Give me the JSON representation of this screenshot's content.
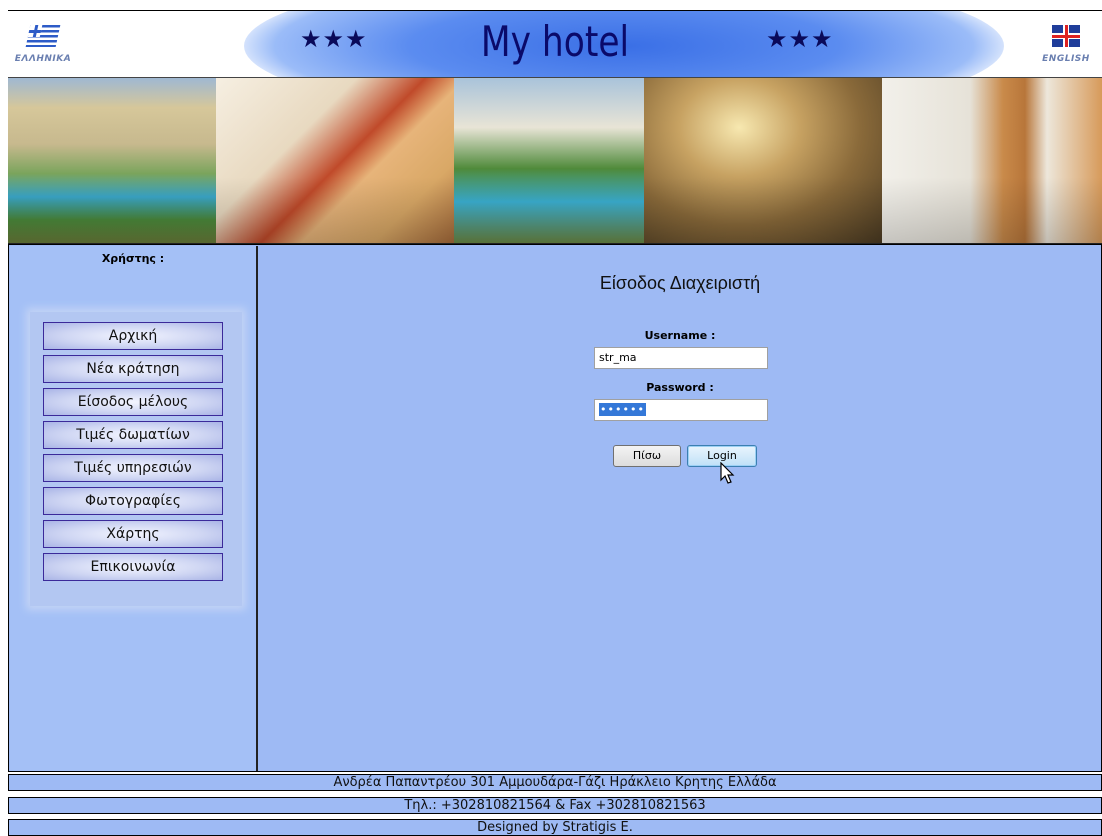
{
  "header": {
    "title": "My hotel",
    "stars_left": "★★★",
    "stars_right": "★★★",
    "lang_greek": "ΕΛΛΗΝΙΚΑ",
    "lang_english": "ENGLISH"
  },
  "sidebar": {
    "user_label": "Χρήστης :",
    "menu": [
      {
        "label": "Αρχική"
      },
      {
        "label": "Νέα κράτηση"
      },
      {
        "label": "Είσοδος μέλους"
      },
      {
        "label": "Τιμές δωματίων"
      },
      {
        "label": "Τιμές υπηρεσιών"
      },
      {
        "label": "Φωτογραφίες"
      },
      {
        "label": "Χάρτης"
      },
      {
        "label": "Επικοινωνία"
      }
    ]
  },
  "login": {
    "title": "Είσοδος Διαχειριστή",
    "username_label": "Username :",
    "username_value": "str_ma",
    "password_label": "Password :",
    "password_masked": "••••••",
    "back_label": "Πίσω",
    "login_label": "Login"
  },
  "footer": {
    "address": "Ανδρέα Παπαντρέου 301 Αμμουδάρα-Γάζι Ηράκλειο Κρητης Ελλάδα",
    "phone": "Τηλ.: +302810821564 & Fax +302810821563",
    "credits": "Designed by Stratigis E."
  },
  "colors": {
    "background": "#9ebaf4",
    "title_blue": "#0a0a6a",
    "menu_border": "#3b2a9a"
  }
}
